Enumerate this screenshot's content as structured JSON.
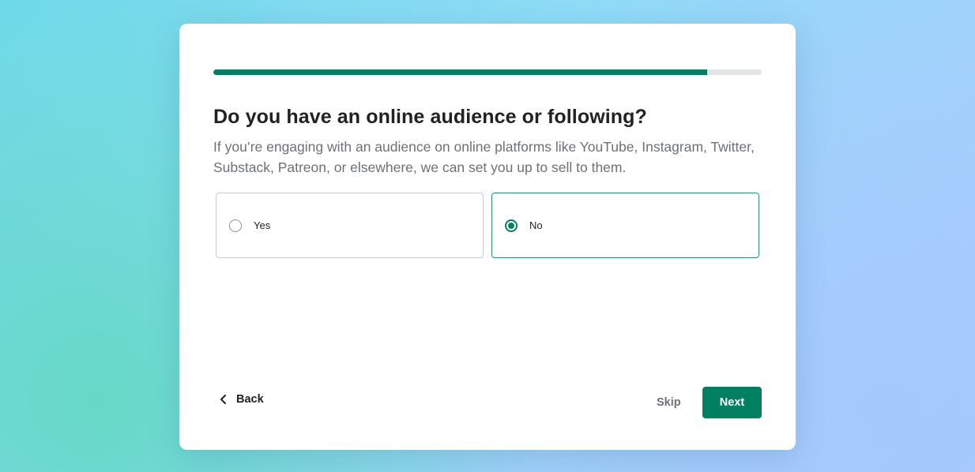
{
  "progress": {
    "value_percent": 90
  },
  "question": {
    "title": "Do you have an online audience or following?",
    "description": "If you’re engaging with an audience on online platforms like YouTube, Instagram, Twitter, Substack, Patreon, or elsewhere, we can set you up to sell to them."
  },
  "options": [
    {
      "label": "Yes",
      "selected": false
    },
    {
      "label": "No",
      "selected": true
    }
  ],
  "footer": {
    "back_label": "Back",
    "skip_label": "Skip",
    "next_label": "Next"
  },
  "colors": {
    "accent": "#008060",
    "title_text": "#202223",
    "muted_text": "#6d7175",
    "track": "#e4e5e7"
  },
  "icons": {
    "back": "chevron-left-icon"
  }
}
